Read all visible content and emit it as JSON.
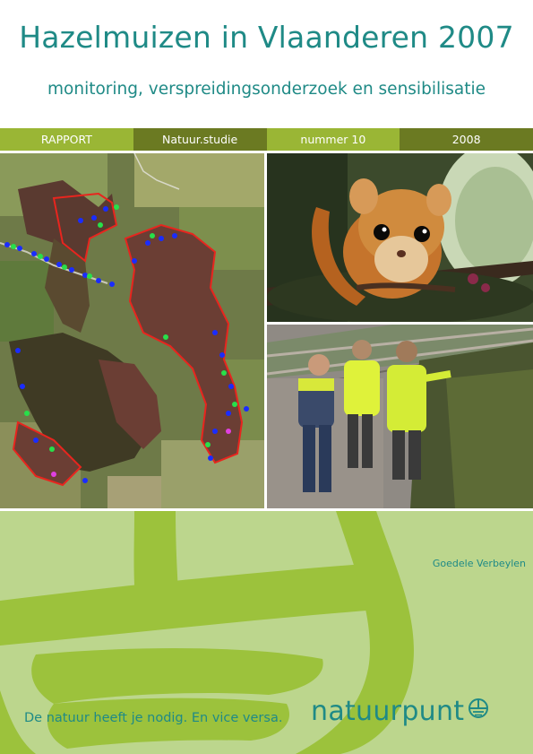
{
  "cover": {
    "title": "Hazelmuizen in Vlaanderen 2007",
    "subtitle": "monitoring, verspreidingsonderzoek en sensibilisatie"
  },
  "band": {
    "type": "RAPPORT",
    "series": "Natuur.studie",
    "number": "nummer 10",
    "year": "2008"
  },
  "photos": {
    "map": "aerial-map-with-survey-points",
    "animal": "hazel-dormouse",
    "fieldwork": "people-in-safety-vests-by-railway"
  },
  "author": "Goedele Verbeylen",
  "slogan": "De natuur heeft je nodig. En vice versa.",
  "logo": {
    "text": "natuurpunt",
    "icon": "natuurpunt-logo-icon"
  },
  "colors": {
    "teal": "#1f8a86",
    "band_light": "#9ab635",
    "band_dark": "#6b7a22",
    "bottom_bg": "#bcd68d",
    "bottom_brush": "#9cc23c"
  }
}
